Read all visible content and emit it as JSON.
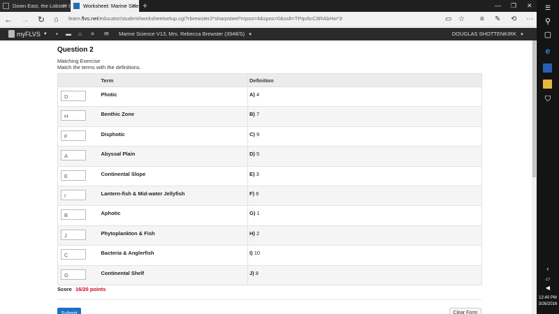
{
  "browser": {
    "tabs": [
      {
        "label": "Down East, the Lobster Hau",
        "active": false
      },
      {
        "label": "Worksheet: Marine Scie",
        "active": true
      }
    ],
    "new_tab_label": "+",
    "url_prefix": "learn.",
    "url_domain": "flvs.net",
    "url_path": "/educator/student/worksheetsetup.cgi?rbrewster2*sharpsteel*mpos=4&spos=0&sslt=TPqv6cC8RAbHw*3948*0007"
  },
  "site_header": {
    "logo": "myFLVS",
    "course": "Marine Science V13, Mrs. Rebecca Brewster (3948/S)",
    "user": "DOUGLAS SHOTTENKIRK"
  },
  "question": {
    "title": "Question 2",
    "type": "Matching Exercise",
    "instructions": "Match the terms with the definitions."
  },
  "table": {
    "headers": {
      "answer": "",
      "term": "Term",
      "definition": "Definition"
    },
    "rows": [
      {
        "answer": "D",
        "term": "Photic",
        "def_letter": "A)",
        "def_text": "4"
      },
      {
        "answer": "H",
        "term": "Benthic Zone",
        "def_letter": "B)",
        "def_text": "7"
      },
      {
        "answer": "F",
        "term": "Disphotic",
        "def_letter": "C)",
        "def_text": "9"
      },
      {
        "answer": "A",
        "term": "Abyssal Plain",
        "def_letter": "D)",
        "def_text": "5"
      },
      {
        "answer": "E",
        "term": "Continental Slope",
        "def_letter": "E)",
        "def_text": "3"
      },
      {
        "answer": "I",
        "term": "Lantern-fish & Mid-water Jellyfish",
        "def_letter": "F)",
        "def_text": "6"
      },
      {
        "answer": "B",
        "term": "Aphotic",
        "def_letter": "G)",
        "def_text": "1"
      },
      {
        "answer": "J",
        "term": "Phytoplankton & Fish",
        "def_letter": "H)",
        "def_text": "2"
      },
      {
        "answer": "C",
        "term": "Bacteria & Anglerfish",
        "def_letter": "I)",
        "def_text": "10"
      },
      {
        "answer": "G",
        "term": "Continental Shelf",
        "def_letter": "J)",
        "def_text": "8"
      }
    ]
  },
  "score": {
    "label": "Score",
    "value": "16/20 points",
    "color": "#d0021b"
  },
  "buttons": {
    "submit": "Submit",
    "clear": "Clear Form"
  },
  "taskbar": {
    "time": "12:40 PM",
    "date": "3/26/2016"
  },
  "colors": {
    "accent": "#1b6fc6",
    "edge": "#1e90ff"
  }
}
